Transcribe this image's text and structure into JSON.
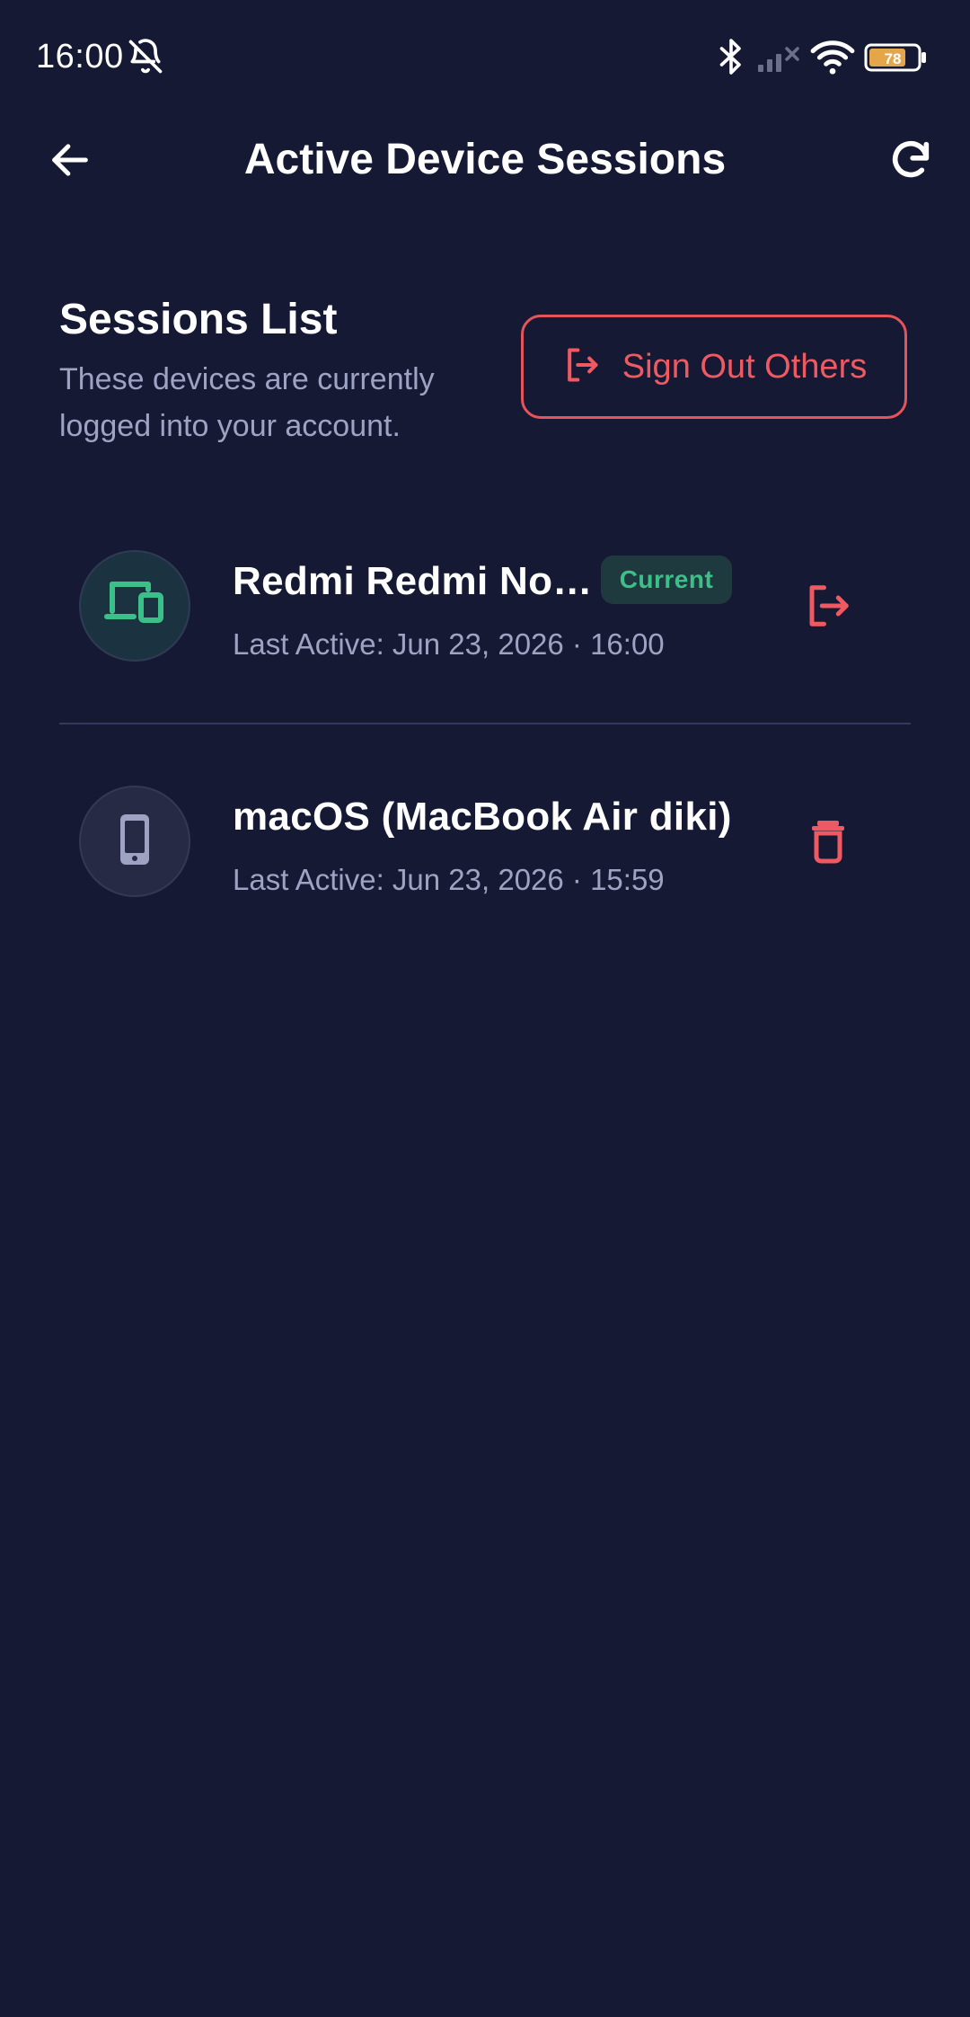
{
  "status_bar": {
    "time": "16:00",
    "battery_level": "78",
    "icons": [
      "bell-off-icon",
      "bluetooth-icon",
      "signal-off-icon",
      "wifi-icon",
      "battery-icon"
    ]
  },
  "app_bar": {
    "title": "Active Device Sessions",
    "back_icon": "arrow-left-icon",
    "refresh_icon": "refresh-icon"
  },
  "section": {
    "title": "Sessions List",
    "description_line1": "These devices are currently",
    "description_line2": "logged into your account.",
    "signout_others_label": "Sign Out Others"
  },
  "sessions": [
    {
      "device_name": "Redmi Redmi No…",
      "badge": "Current",
      "last_active": "Last Active: Jun 23, 2026 · 16:00",
      "device_icon": "devices-icon",
      "action_icon": "logout-icon"
    },
    {
      "device_name": "macOS (MacBook Air diki)",
      "badge": "",
      "last_active": "Last Active: Jun 23, 2026 · 15:59",
      "device_icon": "smartphone-icon",
      "action_icon": "trash-icon"
    }
  ],
  "colors": {
    "background": "#161933",
    "accent_red": "#ef5a62",
    "accent_green": "#3cc089",
    "muted_text": "#9ea3c4"
  }
}
